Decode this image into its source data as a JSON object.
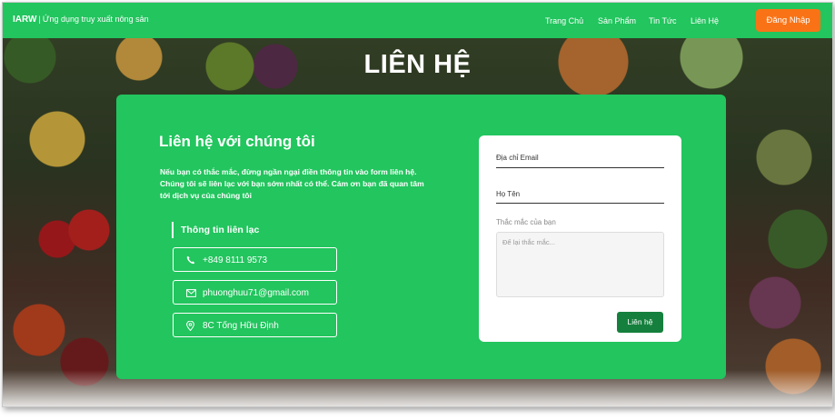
{
  "nav": {
    "brand": "IARW",
    "separator": "|",
    "tagline": "Ứng dụng truy xuất nông sản",
    "menu": [
      "Trang Chủ",
      "Sản Phẩm",
      "Tin Tức",
      "Liên Hệ"
    ],
    "login_label": "Đăng Nhập"
  },
  "hero": {
    "title": "LIÊN HỆ"
  },
  "contact": {
    "heading": "Liên hệ với chúng tôi",
    "description": "Nếu bạn có thắc mắc, đừng ngần ngại điền thông tin vào form liên hệ. Chúng tôi sẽ liên lạc với bạn sớm nhất có thể. Cám ơn bạn đã quan tâm tới dịch vụ của chúng tôi",
    "info_heading": "Thông tin liên lạc",
    "phone": "+849 8111 9573",
    "email": "phuonghuu71@gmail.com",
    "address": "8C Tống Hữu Định"
  },
  "form": {
    "email_label": "Địa chỉ Email",
    "name_label": "Họ Tên",
    "question_label": "Thắc mắc của bạn",
    "question_placeholder": "Để lại thắc mắc...",
    "submit_label": "Liên hệ"
  },
  "colors": {
    "primary": "#22c55e",
    "accent": "#f97316",
    "submit": "#15803d"
  },
  "icons": [
    "phone-icon",
    "mail-icon",
    "location-pin-icon"
  ]
}
